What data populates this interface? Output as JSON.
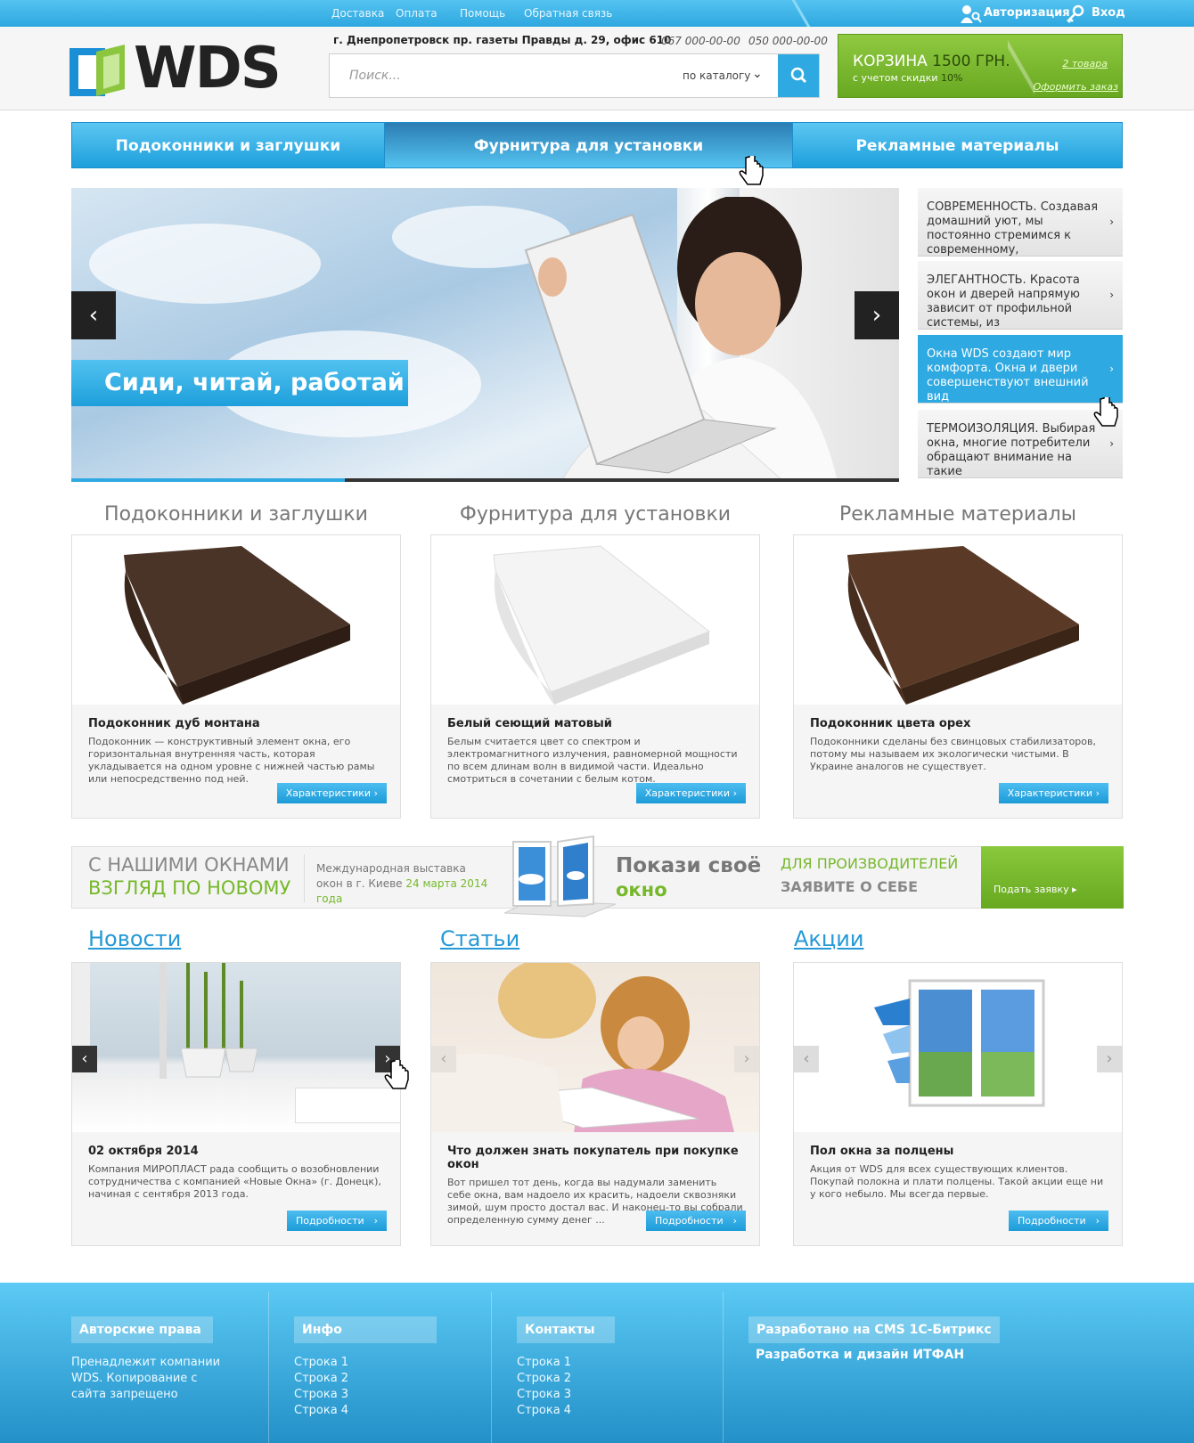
{
  "topbar": {
    "links": [
      "Доставка",
      "Оплата",
      "Помощь",
      "Обратная связь"
    ],
    "auth_label": "Авторизация",
    "login_label": "Вход"
  },
  "header": {
    "logo_text": "WDS",
    "address": "г. Днепропетровск пр. газеты Правды д. 29, офис 610",
    "phones": [
      "067 000-00-00",
      "050 000-00-00"
    ],
    "search": {
      "placeholder": "Поиск...",
      "scope": "по каталогу"
    },
    "cart": {
      "label": "КОРЗИНА",
      "amount": "1500 ГРН.",
      "discount_text": "с учетом скидки",
      "discount_value": "10%",
      "items_link": "2 товара",
      "checkout_link": "Оформить заказ"
    }
  },
  "main_nav": [
    "Подоконники и заглушки",
    "Фурнитура для установки",
    "Рекламные материалы"
  ],
  "slider": {
    "caption": "Сиди, читай, работай",
    "progress": 0.33,
    "side_items": [
      "СОВРЕМЕННОСТЬ. Создавая домашний уют, мы постоянно стремимся к современному,",
      "ЭЛЕГАНТНОСТЬ. Красота окон и дверей напрямую зависит от профильной системы, из",
      "Окна WDS создают мир комфорта. Окна и двери совершенствуют внешний вид",
      "ТЕРМОИЗОЛЯЦИЯ. Выбирая окна, многие потребители обращают внимание на такие"
    ]
  },
  "products": [
    {
      "section": "Подоконники и заглушки",
      "name": "Подоконник дуб монтана",
      "desc": "Подоконник — конструктивный элемент окна, его горизонтальная внутренняя часть, которая укладывается на одном уровне с нижней частью рамы или непосредственно под ней.",
      "button": "Характеристики",
      "color": "#4a3327"
    },
    {
      "section": "Фурнитура для установки",
      "name": "Белый сеющий матовый",
      "desc": "Белым считается цвет со спектром и электромагнитного излучения, равномерной мощности по всем длинам волн в видимой части. Идеально смотриться в сочетании с белым котом.",
      "button": "Характеристики",
      "color": "#f2f2f2"
    },
    {
      "section": "Рекламные материалы",
      "name": "Подоконник цвета орех",
      "desc": "Подоконники сделаны без свинцовых стабилизаторов, потому мы называем их экологически чистыми. В Украине аналогов не существует.",
      "button": "Характеристики",
      "color": "#5a3a26"
    }
  ],
  "banner": {
    "line1": "С НАШИМИ ОКНАМИ",
    "line2": "ВЗГЛЯД ПО НОВОМУ",
    "expo_text": "Международная выставка окон в г. Киеве",
    "expo_date": "24 марта 2014 года",
    "show_line1": "Покази своё",
    "show_line2": "окно",
    "producers_line1": "ДЛЯ ПРОИЗВОДИТЕЛЕЙ",
    "producers_line2": "ЗАЯВИТЕ О СЕБЕ",
    "apply_button": "Подать заявку"
  },
  "news": [
    {
      "section": "Новости",
      "title": "02 октября 2014",
      "text": "Компания МИРОПЛАСТ рада сообщить о возобновлении сотрудничества с компанией «Новые Окна» (г. Донецк), начиная с сентября 2013 года.",
      "button": "Подробности"
    },
    {
      "section": "Статьи",
      "title": "Что должен знать покупатель при покупке окон",
      "text": "Вот пришел тот день, когда вы надумали заменить себе окна, вам надоело их красить, надоели сквозняки зимой, шум просто достал вас. И наконец-то вы собрали определенную сумму денег ...",
      "button": "Подробности"
    },
    {
      "section": "Акции",
      "title": "Пол окна за полцены",
      "text": "Акция от WDS для всех существующих клиентов. Покупай полокна и плати полцены. Такой акции еще ни у кого небыло. Мы всегда первые.",
      "button": "Подробности"
    }
  ],
  "footer": {
    "copyright_title": "Авторские права",
    "copyright_text": "Пренадлежит компании WDS. Копирование с сайта запрещено",
    "info_title": "Инфо",
    "info_items": [
      "Строка 1",
      "Строка 2",
      "Строка 3",
      "Строка 4"
    ],
    "contacts_title": "Контакты",
    "contacts_items": [
      "Строка 1",
      "Строка 2",
      "Строка 3",
      "Строка 4"
    ],
    "dev_title": "Разработано на CMS 1С-Битрикс",
    "dev_text": "Разработка и дизайн ИТФАН"
  },
  "colors": {
    "accent_blue": "#2ea9e1",
    "accent_green": "#76b82a",
    "link_blue": "#2699d6"
  }
}
